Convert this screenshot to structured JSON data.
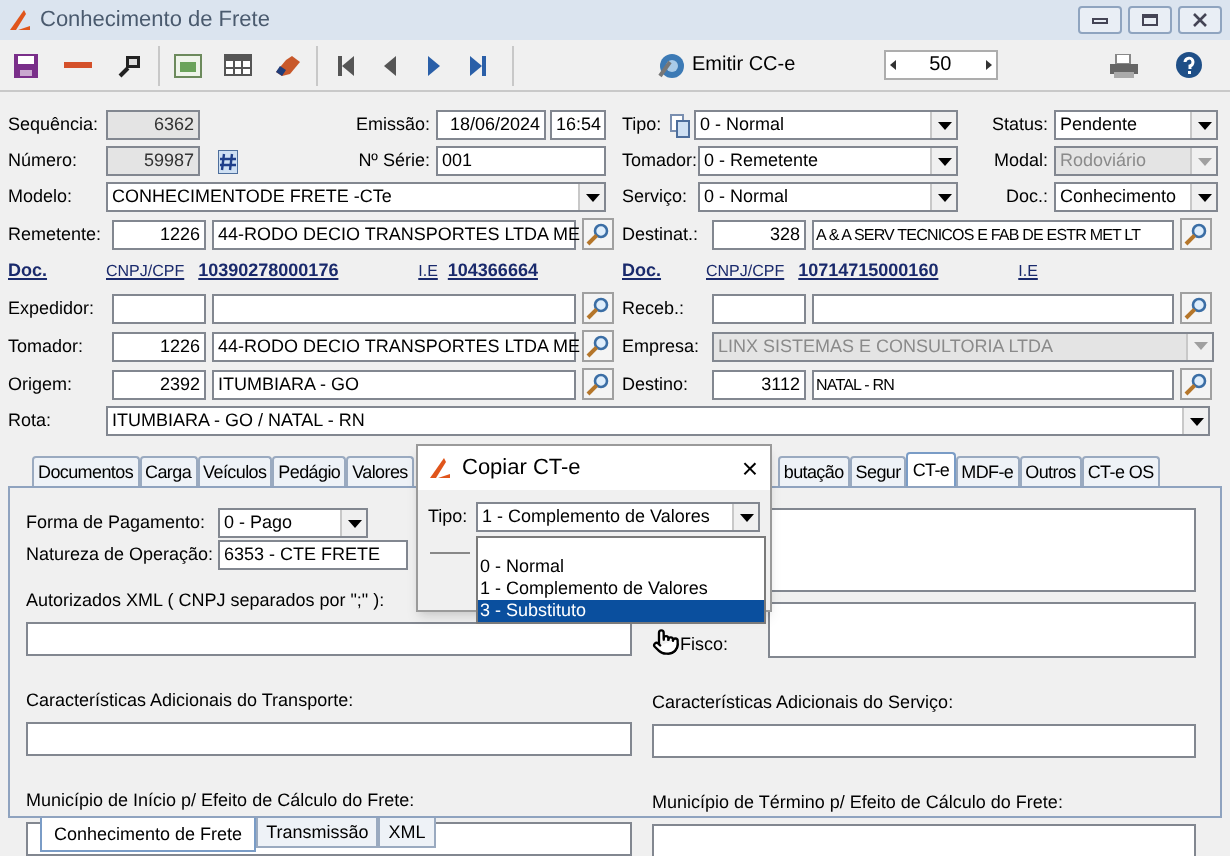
{
  "window": {
    "title": "Conhecimento de Frete"
  },
  "toolbar": {
    "emit_button": "Emitir CC-e",
    "spinner_value": "50"
  },
  "header": {
    "sequencia": {
      "label": "Sequência:",
      "value": "6362"
    },
    "numero": {
      "label": "Número:",
      "value": "59987"
    },
    "emissao": {
      "label": "Emissão:",
      "date": "18/06/2024",
      "time": "16:54"
    },
    "serie": {
      "label": "Nº Série:",
      "value": "001"
    },
    "modelo": {
      "label": "Modelo:",
      "value": "CONHECIMENTODE FRETE -CTe",
      "disabled": false
    },
    "tipo": {
      "label": "Tipo:",
      "value": "0 - Normal",
      "disabled": false
    },
    "tomador": {
      "label": "Tomador:",
      "value": "0 - Remetente",
      "disabled": false
    },
    "servico": {
      "label": "Serviço:",
      "value": "0 - Normal",
      "disabled": false
    },
    "status": {
      "label": "Status:",
      "value": "Pendente",
      "disabled": false
    },
    "modal": {
      "label": "Modal:",
      "value": "Rodoviário",
      "disabled": true
    },
    "doc": {
      "label": "Doc.:",
      "value": "Conhecimento",
      "disabled": false
    }
  },
  "party_rows": [
    {
      "left": {
        "kind": "lookup",
        "label": "Remetente:",
        "code": "1226",
        "name": "44-RODO DECIO TRANSPORTES LTDA ME"
      },
      "right": {
        "kind": "lookup",
        "label": "Destinat.:",
        "code": "328",
        "name": "A & A SERV TECNICOS E FAB DE ESTR MET LT"
      }
    },
    {
      "left": {
        "kind": "doc",
        "label": "Doc.",
        "cnpj_label": "CNPJ/CPF",
        "cnpj": "10390278000176",
        "ie_label": "I.E",
        "ie": "104366664"
      },
      "right": {
        "kind": "doc",
        "label": "Doc.",
        "cnpj_label": "CNPJ/CPF",
        "cnpj": "10714715000160",
        "ie_label": "I.E"
      }
    },
    {
      "left": {
        "kind": "lookup",
        "label": "Expedidor:"
      },
      "right": {
        "kind": "lookup",
        "label": "Receb.:"
      }
    },
    {
      "left": {
        "kind": "lookup",
        "label": "Tomador:",
        "code": "1226",
        "name": "44-RODO DECIO TRANSPORTES LTDA ME"
      },
      "right": {
        "kind": "combo",
        "label": "Empresa:",
        "value": "LINX SISTEMAS E CONSULTORIA LTDA",
        "disabled": true
      }
    },
    {
      "left": {
        "kind": "lookup",
        "label": "Origem:",
        "code": "2392",
        "name": "ITUMBIARA - GO"
      },
      "right": {
        "kind": "lookup",
        "label": "Destino:",
        "code": "3112",
        "name": "NATAL - RN"
      }
    }
  ],
  "rota": {
    "label": "Rota:",
    "value": "ITUMBIARA - GO / NATAL - RN",
    "disabled": false
  },
  "tabs": [
    {
      "label": "Documentos",
      "selected": false
    },
    {
      "label": "Carga",
      "selected": false
    },
    {
      "label": "Veículos",
      "selected": false
    },
    {
      "label": "Pedágio",
      "selected": false
    },
    {
      "label": "Valores",
      "selected": false
    },
    {
      "label": "butação",
      "selected": false
    },
    {
      "label": "Segur",
      "selected": false
    },
    {
      "label": "CT-e",
      "selected": true
    },
    {
      "label": "MDF-e",
      "selected": false
    },
    {
      "label": "Outros",
      "selected": false
    },
    {
      "label": "CT-e OS",
      "selected": false
    }
  ],
  "panel": {
    "forma_pagamento": {
      "label": "Forma de Pagamento:",
      "value": "0 - Pago",
      "disabled": false
    },
    "natureza": {
      "label": "Natureza de Operação:",
      "value": "6353 - CTE FRETE"
    },
    "autorizados": {
      "label": "Autorizados XML ( CNPJ separados por \";\" ):"
    },
    "fisco": {
      "label": "Fisco:"
    },
    "carac_transporte": {
      "label": "Características Adicionais do Transporte:"
    },
    "carac_servico": {
      "label": "Características Adicionais do Serviço:"
    },
    "mun_inicio": {
      "label": "Município de Início p/ Efeito de Cálculo do Frete:"
    },
    "mun_termino": {
      "label": "Município de Término p/ Efeito de Cálculo do Frete:"
    }
  },
  "bottom_tabs": [
    {
      "label": "Conhecimento de Frete",
      "selected": true
    },
    {
      "label": "Transmissão",
      "selected": false
    },
    {
      "label": "XML",
      "selected": false
    }
  ],
  "dialog": {
    "title": "Copiar CT-e",
    "close": "×",
    "tipo_label": "Tipo:",
    "tipo": {
      "value": "1 - Complemento de Valores",
      "disabled": false
    },
    "options": [
      {
        "label": "0 - Normal",
        "selected": false
      },
      {
        "label": "1 - Complemento de Valores",
        "selected": false
      },
      {
        "label": "3 - Substituto",
        "selected": true
      }
    ]
  }
}
